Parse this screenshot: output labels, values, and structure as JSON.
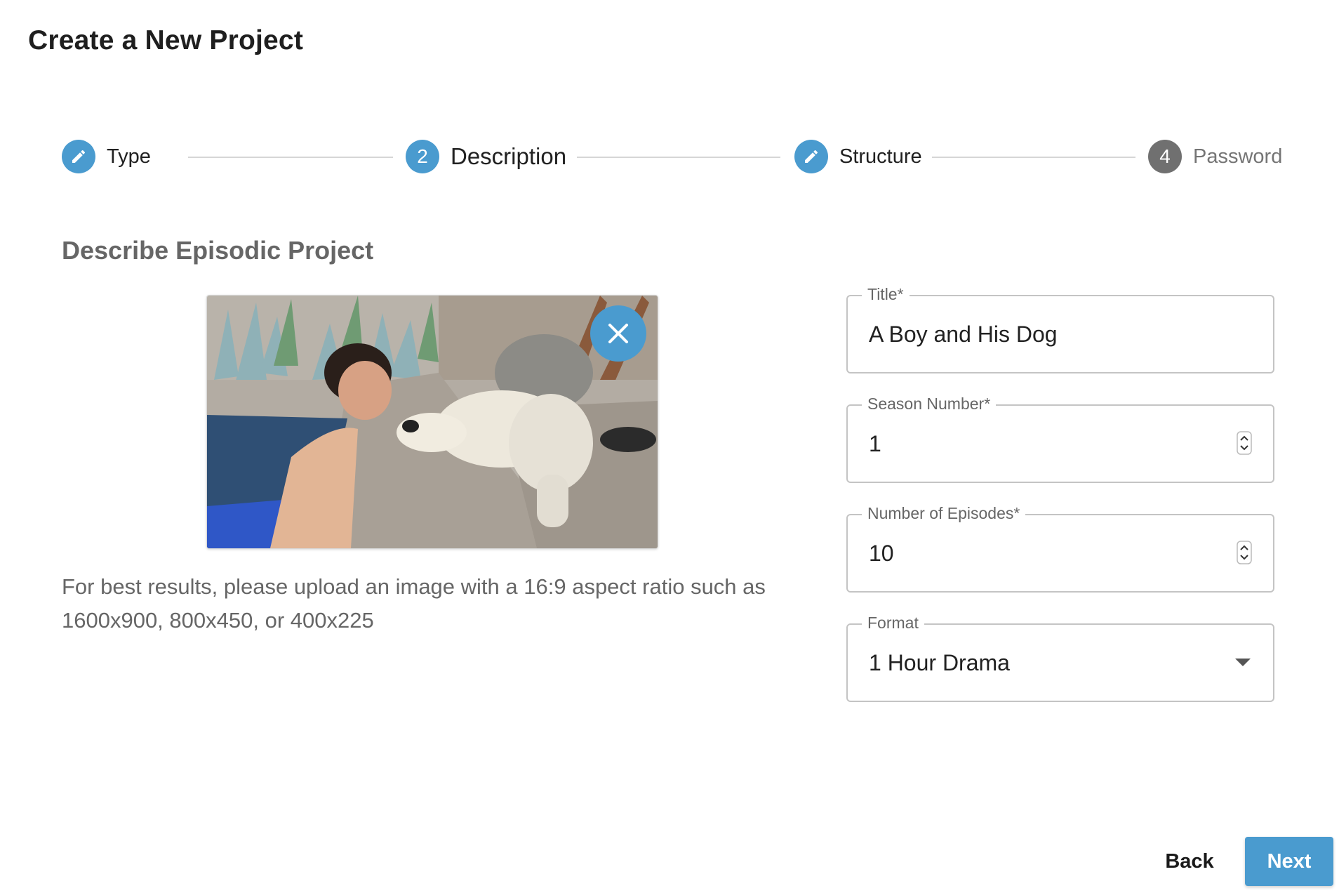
{
  "page_title": "Create a New Project",
  "stepper": {
    "steps": [
      {
        "label": "Type",
        "icon": "pencil-icon",
        "state": "completed"
      },
      {
        "label": "Description",
        "number": "2",
        "state": "active"
      },
      {
        "label": "Structure",
        "icon": "pencil-icon",
        "state": "completed"
      },
      {
        "label": "Password",
        "number": "4",
        "state": "inactive"
      }
    ]
  },
  "section_title": "Describe Episodic Project",
  "image": {
    "alt": "Boy in pool next to a dog resting on the pool edge",
    "remove_icon": "close-icon"
  },
  "hint": "For best results, please upload an image with a 16:9 aspect ratio such as 1600x900, 800x450, or 400x225",
  "form": {
    "title": {
      "label": "Title*",
      "value": "A Boy and His Dog"
    },
    "season_number": {
      "label": "Season Number*",
      "value": "1"
    },
    "episodes": {
      "label": "Number of Episodes*",
      "value": "10"
    },
    "format": {
      "label": "Format",
      "value": "1 Hour Drama"
    }
  },
  "buttons": {
    "back": "Back",
    "next": "Next"
  },
  "colors": {
    "accent": "#4a9bcf",
    "inactive_step": "#707070"
  }
}
